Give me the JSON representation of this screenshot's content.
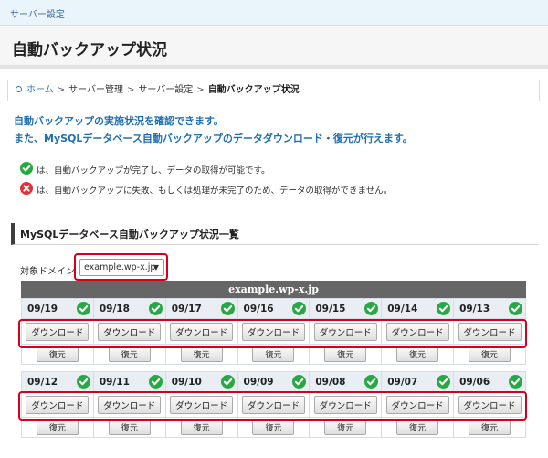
{
  "tab": {
    "label": "サーバー設定"
  },
  "header": {
    "title": "自動バックアップ状況"
  },
  "breadcrumb": {
    "home": "ホーム",
    "items": [
      "サーバー管理",
      "サーバー設定"
    ],
    "current": "自動バックアップ状況",
    "separator": ">"
  },
  "intro": {
    "line1": "自動バックアップの実施状況を確認できます。",
    "line2": "また、MySQLデータベース自動バックアップのデータダウンロード・復元が行えます。"
  },
  "legend": {
    "success": "は、自動バックアップが完了し、データの取得が可能です。",
    "failure": "は、自動バックアップに失敗、もしくは処理が未完了のため、データの取得ができません。",
    "success_icon": "check-circle-icon",
    "failure_icon": "x-circle-icon"
  },
  "section": {
    "title": "MySQLデータベース自動バックアップ状況一覧"
  },
  "domain_select": {
    "label": "対象ドメイン",
    "value": "example.wp-x.jp"
  },
  "table": {
    "domain_header": "example.wp-x.jp",
    "download_label": "ダウンロード",
    "restore_label": "復元",
    "weeks": [
      {
        "dates": [
          "09/19",
          "09/18",
          "09/17",
          "09/16",
          "09/15",
          "09/14",
          "09/13"
        ]
      },
      {
        "dates": [
          "09/12",
          "09/11",
          "09/10",
          "09/09",
          "09/08",
          "09/07",
          "09/06"
        ]
      }
    ]
  },
  "colors": {
    "accent": "#1f6fb0",
    "success": "#27a844",
    "failure": "#d9343b",
    "highlight": "#d6001c",
    "table_header": "#666666"
  }
}
